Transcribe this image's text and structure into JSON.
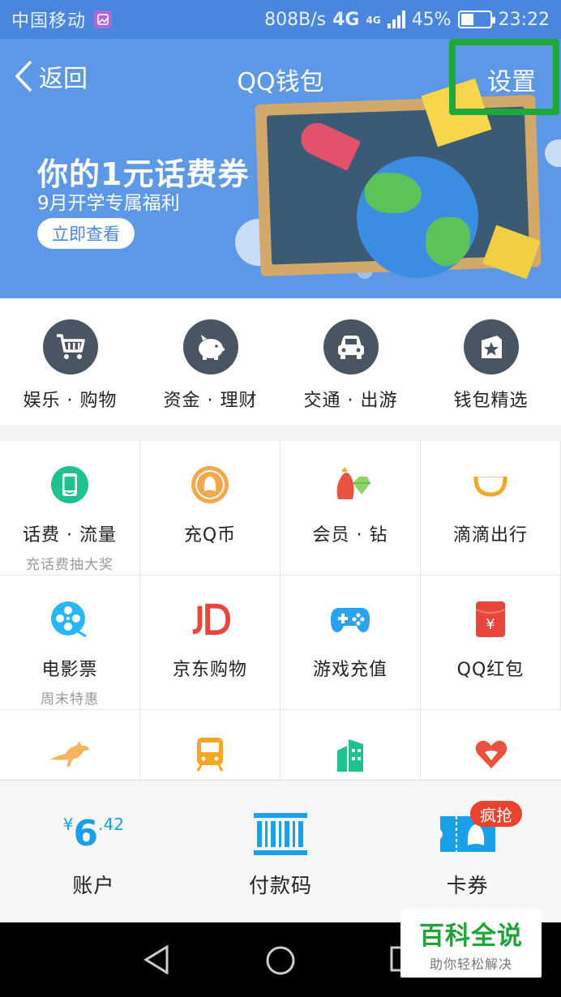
{
  "status_bar": {
    "carrier": "中国移动",
    "speed": "808B/s",
    "network": "4G",
    "network2": "4G",
    "battery": "45%",
    "battery_level": 0.45,
    "time": "23:22"
  },
  "nav": {
    "back_label": "返回",
    "title": "QQ钱包",
    "settings_label": "设置"
  },
  "banner": {
    "title": "你的1元话费券",
    "subtitle": "9月开学专属福利",
    "button": "立即查看"
  },
  "categories": [
    {
      "label": "娱乐 · 购物",
      "icon": "shopping-cart-icon"
    },
    {
      "label": "资金 · 理财",
      "icon": "piggy-bank-icon"
    },
    {
      "label": "交通 · 出游",
      "icon": "car-icon"
    },
    {
      "label": "钱包精选",
      "icon": "star-card-icon"
    }
  ],
  "services": [
    {
      "title": "话费 · 流量",
      "sub": "充话费抽大奖",
      "icon": "phone-icon",
      "color": "#1fc28f"
    },
    {
      "title": "充Q币",
      "sub": "",
      "icon": "qq-coin-icon",
      "color": "#f5a84b"
    },
    {
      "title": "会员 · 钻",
      "sub": "",
      "icon": "membership-diamond-icon",
      "color": "#e8533f"
    },
    {
      "title": "滴滴出行",
      "sub": "",
      "icon": "didi-icon",
      "color": "#f5a623"
    },
    {
      "title": "电影票",
      "sub": "周末特惠",
      "icon": "film-reel-icon",
      "color": "#29b6f6"
    },
    {
      "title": "京东购物",
      "sub": "",
      "icon": "jd-icon",
      "color": "#e8453c"
    },
    {
      "title": "游戏充值",
      "sub": "",
      "icon": "gamepad-icon",
      "color": "#29a3f0"
    },
    {
      "title": "QQ红包",
      "sub": "",
      "icon": "red-packet-icon",
      "color": "#e8453c"
    },
    {
      "title": "",
      "sub": "",
      "icon": "kangaroo-icon",
      "color": "#f5b55b"
    },
    {
      "title": "",
      "sub": "",
      "icon": "train-icon",
      "color": "#f5a623"
    },
    {
      "title": "",
      "sub": "",
      "icon": "building-icon",
      "color": "#1fc28f"
    },
    {
      "title": "",
      "sub": "",
      "icon": "heart-charity-icon",
      "color": "#e8533f"
    }
  ],
  "bottom_bar": {
    "account": {
      "currency": "¥",
      "integer": "6",
      "decimal": ".42",
      "label": "账户"
    },
    "paycode": {
      "label": "付款码"
    },
    "coupons": {
      "label": "卡券",
      "badge": "疯抢"
    }
  },
  "watermark": {
    "title": "百科全说",
    "subtitle": "助你轻松解决"
  }
}
